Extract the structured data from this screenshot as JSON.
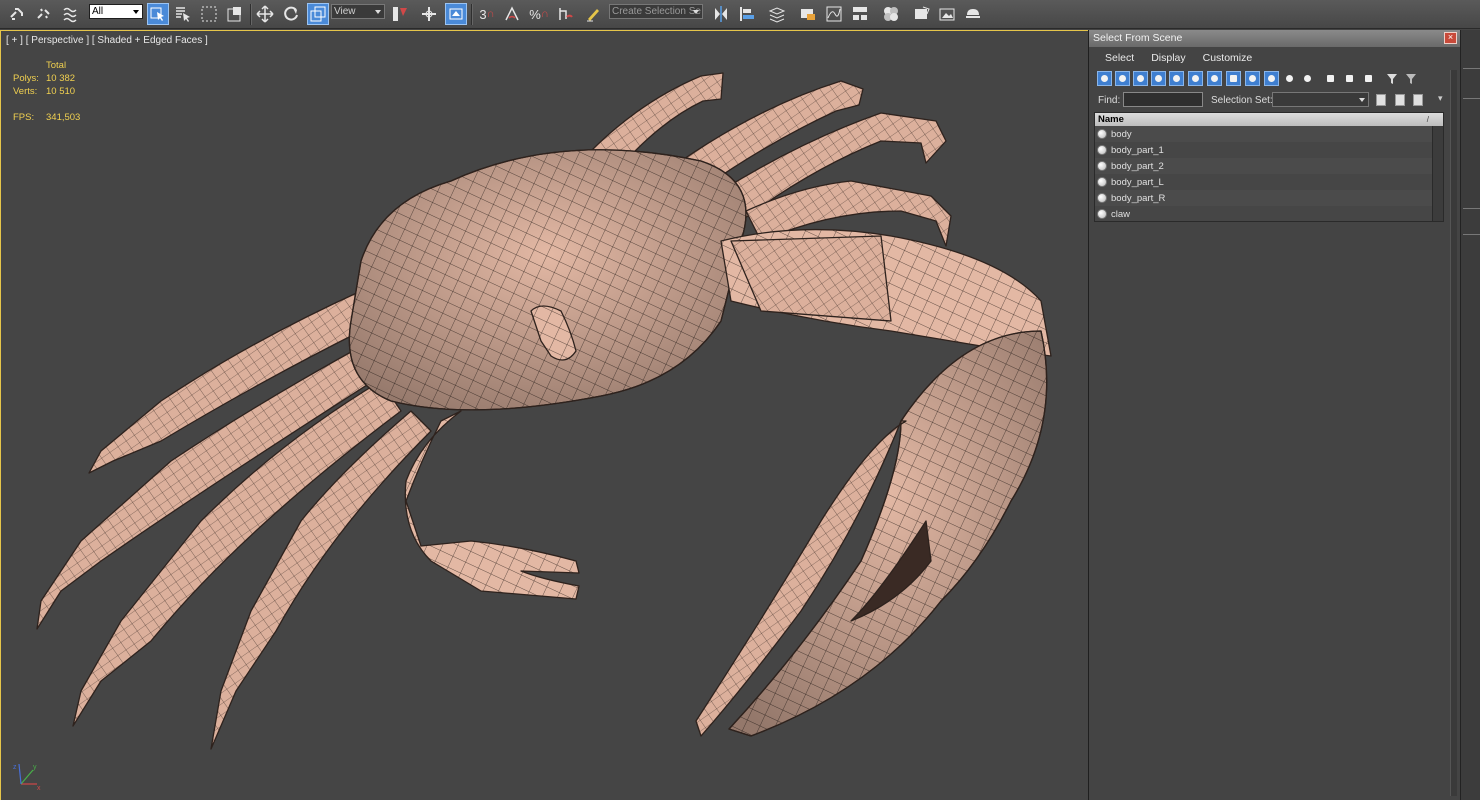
{
  "toolbar": {
    "selection_filter": "All",
    "reference_coord": "View",
    "named_selection_placeholder": "Create Selection Se",
    "snap_3d_label": "3",
    "percent_snap_label": "%"
  },
  "viewport": {
    "label": "[ + ] [ Perspective ] [ Shaded + Edged Faces ]",
    "stats": {
      "header": "Total",
      "polys_label": "Polys:",
      "polys_value": "10 382",
      "verts_label": "Verts:",
      "verts_value": "10 510",
      "fps_label": "FPS:",
      "fps_value": "341,503"
    },
    "axis": {
      "x": "x",
      "y": "y",
      "z": "z"
    }
  },
  "panel": {
    "title": "Select From Scene",
    "close_glyph": "×",
    "menus": [
      "Select",
      "Display",
      "Customize"
    ],
    "find_label": "Find:",
    "find_value": "",
    "selection_set_label": "Selection Set:",
    "column_header": "Name",
    "objects": [
      "body",
      "body_part_1",
      "body_part_2",
      "body_part_L",
      "body_part_R",
      "claw"
    ]
  },
  "colors": {
    "viewport_bg": "#454545",
    "mesh_fill": "#e3b8a4",
    "mesh_wire": "#3a2c26",
    "stats_text": "#f0d050",
    "active_border": "#e5c54a",
    "accent_blue": "#3f7fd0"
  }
}
